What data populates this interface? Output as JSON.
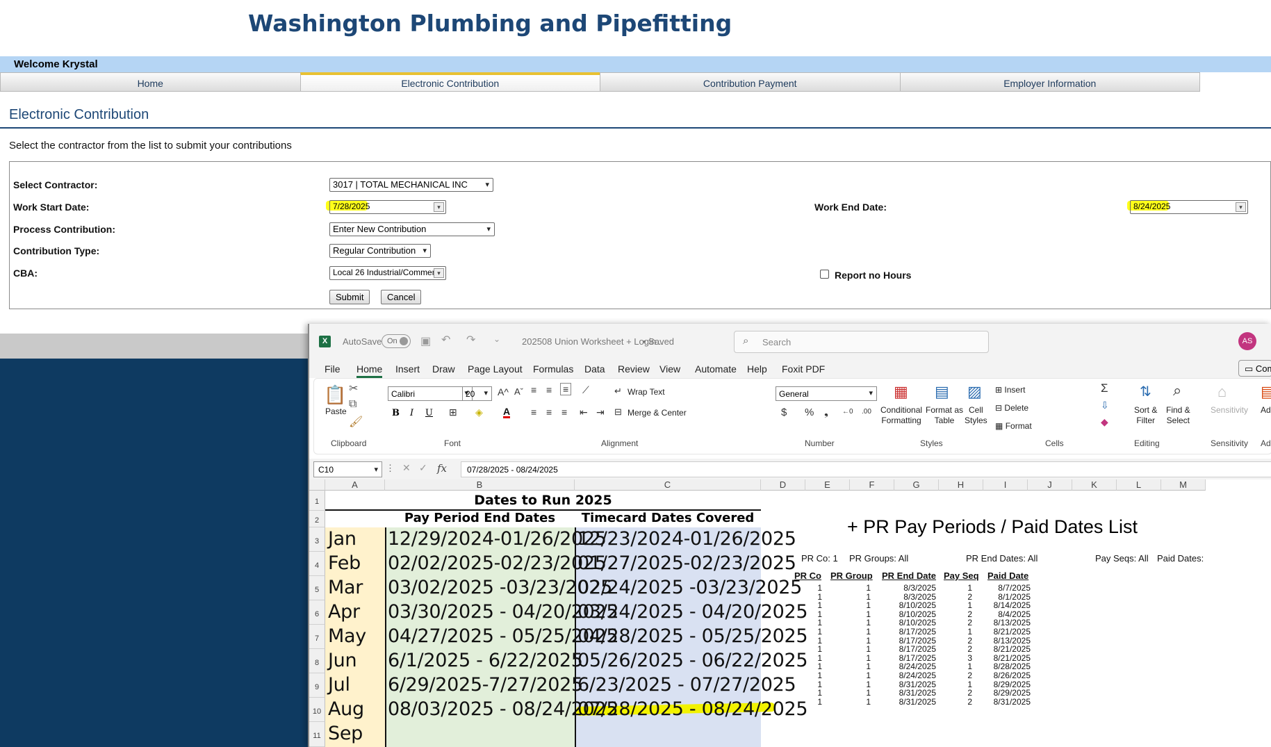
{
  "site": {
    "title": "Washington Plumbing and Pipefitting",
    "welcome": "Welcome Krystal"
  },
  "nav": {
    "tabs": [
      "Home",
      "Electronic Contribution",
      "Contribution Payment",
      "Employer Information"
    ],
    "active": "Electronic Contribution"
  },
  "page": {
    "heading": "Electronic Contribution",
    "instruction": "Select the contractor from the list to submit your contributions"
  },
  "form": {
    "contractor_label": "Select Contractor:",
    "contractor_value": "3017 | TOTAL MECHANICAL INC",
    "work_start_label": "Work Start Date:",
    "work_start_value": "7/28/2025",
    "work_end_label": "Work End Date:",
    "work_end_value": "8/24/2025",
    "process_label": "Process Contribution:",
    "process_value": "Enter New Contribution",
    "type_label": "Contribution Type:",
    "type_value": "Regular Contribution",
    "cba_label": "CBA:",
    "cba_value": "Local 26 Industrial/Commer",
    "report_no_hours_label": "Report no Hours",
    "report_no_hours_checked": false,
    "submit_label": "Submit",
    "cancel_label": "Cancel"
  },
  "excel": {
    "autosave_label": "AutoSave",
    "autosave_state": "On",
    "doc_title": "202508 Union Worksheet + Login...",
    "saved_label": "• Saved",
    "search_placeholder": "Search",
    "avatar": "AS",
    "comments_label": "Com",
    "menu": [
      "File",
      "Home",
      "Insert",
      "Draw",
      "Page Layout",
      "Formulas",
      "Data",
      "Review",
      "View",
      "Automate",
      "Help",
      "Foxit PDF"
    ],
    "active_menu": "Home",
    "ribbon": {
      "paste": "Paste",
      "font_name": "Calibri",
      "font_size": "20",
      "wrap_text": "Wrap Text",
      "merge_center": "Merge & Center",
      "number_format": "General",
      "conditional_formatting": [
        "Conditional",
        "Formatting"
      ],
      "format_as_table": [
        "Format as",
        "Table"
      ],
      "cell_styles": [
        "Cell",
        "Styles"
      ],
      "insert": "Insert",
      "delete": "Delete",
      "format": "Format",
      "sort_filter": [
        "Sort &",
        "Filter"
      ],
      "find_select": [
        "Find &",
        "Select"
      ],
      "sensitivity": "Sensitivity",
      "add_partial": "Add",
      "groups": [
        "Clipboard",
        "Font",
        "Alignment",
        "Number",
        "Styles",
        "Cells",
        "Editing",
        "Sensitivity",
        "Add"
      ]
    },
    "name_box": "C10",
    "formula": "07/28/2025 - 08/24/2025",
    "columns": [
      "A",
      "B",
      "C",
      "D",
      "E",
      "F",
      "G",
      "H",
      "I",
      "J",
      "K",
      "L",
      "M"
    ],
    "rows": [
      "1",
      "2",
      "3",
      "4",
      "5",
      "6",
      "7",
      "8",
      "9",
      "10",
      "11"
    ],
    "sheet": {
      "title": "Dates to Run 2025",
      "header_b": "Pay Period End Dates",
      "header_c": "Timecard Dates Covered",
      "data": [
        [
          "Jan",
          "12/29/2024-01/26/2025",
          "12/23/2024-01/26/2025"
        ],
        [
          "Feb",
          "02/02/2025-02/23/2025",
          "01/27/2025-02/23/2025"
        ],
        [
          "Mar",
          "03/02/2025 -03/23/2025",
          "02/24/2025 -03/23/2025"
        ],
        [
          "Apr",
          "03/30/2025 - 04/20/2025",
          "03/24/2025 - 04/20/2025"
        ],
        [
          "May",
          "04/27/2025 - 05/25/2025",
          "04/28/2025 - 05/25/2025"
        ],
        [
          "Jun",
          "6/1/2025 - 6/22/2025",
          "05/26/2025 - 06/22/2025"
        ],
        [
          "Jul",
          "6/29/2025-7/27/2025",
          "6/23/2025 - 07/27/2025"
        ],
        [
          "Aug",
          "08/03/2025 - 08/24/2025",
          "07/28/2025 - 08/24/2025"
        ],
        [
          "Sep",
          "",
          ""
        ]
      ]
    },
    "pr_report": {
      "title": "+ PR Pay Periods / Paid Dates List",
      "filters": [
        "PR Co: 1",
        "PR Groups: All",
        "PR End Dates: All",
        "Pay Seqs: All",
        "Paid Dates:"
      ],
      "headers": [
        "PR Co",
        "PR Group",
        "PR End Date",
        "Pay Seq",
        "Paid Date"
      ],
      "rows": [
        [
          "1",
          "1",
          "8/3/2025",
          "1",
          "8/7/2025"
        ],
        [
          "1",
          "1",
          "8/3/2025",
          "2",
          "8/1/2025"
        ],
        [
          "1",
          "1",
          "8/10/2025",
          "1",
          "8/14/2025"
        ],
        [
          "1",
          "1",
          "8/10/2025",
          "2",
          "8/4/2025"
        ],
        [
          "1",
          "1",
          "8/10/2025",
          "2",
          "8/13/2025"
        ],
        [
          "1",
          "1",
          "8/17/2025",
          "1",
          "8/21/2025"
        ],
        [
          "1",
          "1",
          "8/17/2025",
          "2",
          "8/13/2025"
        ],
        [
          "1",
          "1",
          "8/17/2025",
          "2",
          "8/21/2025"
        ],
        [
          "1",
          "1",
          "8/17/2025",
          "3",
          "8/21/2025"
        ],
        [
          "1",
          "1",
          "8/24/2025",
          "1",
          "8/28/2025"
        ],
        [
          "1",
          "1",
          "8/24/2025",
          "2",
          "8/26/2025"
        ],
        [
          "1",
          "1",
          "8/31/2025",
          "1",
          "8/29/2025"
        ],
        [
          "1",
          "1",
          "8/31/2025",
          "2",
          "8/29/2025"
        ],
        [
          "1",
          "1",
          "8/31/2025",
          "2",
          "8/31/2025"
        ]
      ]
    }
  },
  "colors": {
    "brand": "#1d4776",
    "welcome_bar": "#b5d5f4",
    "highlight": "#ffff1a",
    "navy_bg": "#0e3a61"
  }
}
